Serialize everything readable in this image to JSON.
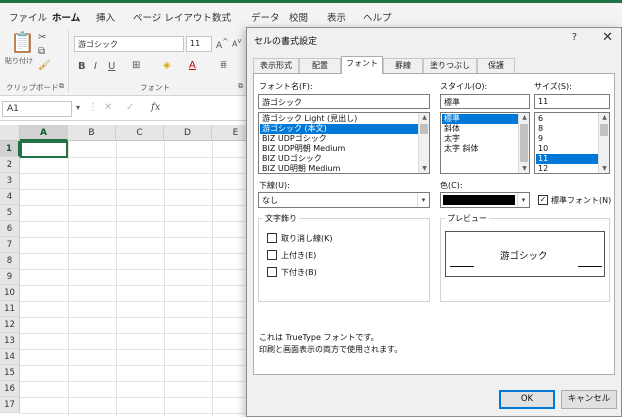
{
  "menu": {
    "items": [
      "ファイル",
      "ホーム",
      "挿入",
      "ページ レイアウト",
      "数式",
      "データ",
      "校閲",
      "表示",
      "ヘルプ"
    ],
    "active": "ホーム"
  },
  "ribbon": {
    "clipboard_label": "クリップボード",
    "paste_label": "貼り付け",
    "font_group_label": "フォント",
    "font_name": "游ゴシック",
    "font_size": "11"
  },
  "formula_bar": {
    "name_box": "A1",
    "fx": "fx"
  },
  "sheet": {
    "columns": [
      "A",
      "B",
      "C",
      "D",
      "E"
    ],
    "rows": [
      "1",
      "2",
      "3",
      "4",
      "5",
      "6",
      "7",
      "8",
      "9",
      "10",
      "11",
      "12",
      "13",
      "14",
      "15",
      "16",
      "17"
    ],
    "selected_cell": "A1"
  },
  "dialog": {
    "title": "セルの書式設定",
    "help": "?",
    "close": "✕",
    "tabs": [
      "表示形式",
      "配置",
      "フォント",
      "罫線",
      "塗りつぶし",
      "保護"
    ],
    "active_tab": "フォント",
    "font_label": "フォント名(F):",
    "font_value": "游ゴシック",
    "font_list": [
      "游ゴシック Light (見出し)",
      "游ゴシック (本文)",
      "BIZ UDPゴシック",
      "BIZ UDP明朝 Medium",
      "BIZ UDゴシック",
      "BIZ UD明朝 Medium"
    ],
    "font_selected_index": 1,
    "style_label": "スタイル(O):",
    "style_value": "標準",
    "style_list": [
      "標準",
      "斜体",
      "太字",
      "太字 斜体"
    ],
    "style_selected_index": 0,
    "size_label": "サイズ(S):",
    "size_value": "11",
    "size_list": [
      "6",
      "8",
      "9",
      "10",
      "11",
      "12"
    ],
    "size_selected_index": 4,
    "underline_label": "下線(U):",
    "underline_value": "なし",
    "color_label": "色(C):",
    "color_value": "#000000",
    "normal_font_label": "標準フォント(N)",
    "normal_font_checked": true,
    "effects_label": "文字飾り",
    "strikethrough_label": "取り消し線(K)",
    "superscript_label": "上付き(E)",
    "subscript_label": "下付き(B)",
    "preview_label": "プレビュー",
    "preview_text": "游ゴシック",
    "info_line1": "これは TrueType フォントです。",
    "info_line2": "印刷と画面表示の両方で使用されます。",
    "ok_label": "OK",
    "cancel_label": "キャンセル"
  },
  "colors": {
    "excel_green": "#217346",
    "selection_blue": "#0078d7"
  }
}
